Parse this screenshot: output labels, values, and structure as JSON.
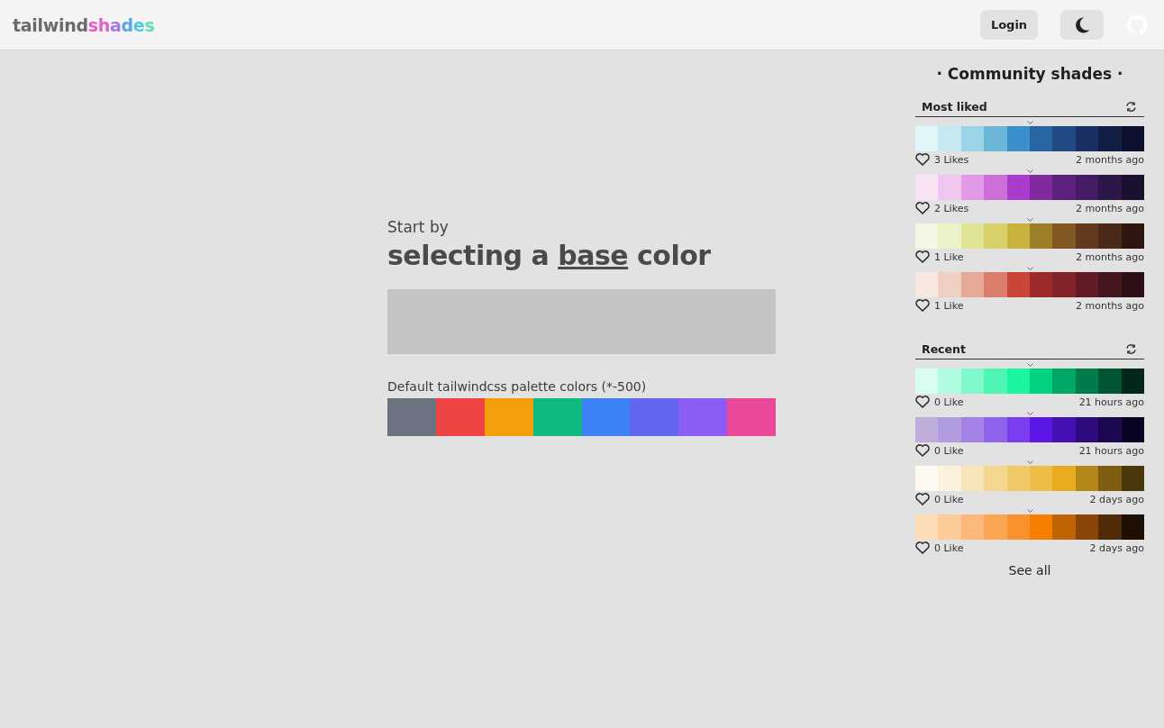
{
  "header": {
    "logo": [
      {
        "text": "tailwind",
        "color": "#6b6b6b"
      },
      {
        "text": "s",
        "color": "#e85bc6"
      },
      {
        "text": "h",
        "color": "#e15fd0"
      },
      {
        "text": "a",
        "color": "#a57ae0"
      },
      {
        "text": "d",
        "color": "#5aa6e6"
      },
      {
        "text": "e",
        "color": "#52c9dd"
      },
      {
        "text": "s",
        "color": "#5fe0b0"
      }
    ],
    "login": "Login"
  },
  "main": {
    "intro": "Start by",
    "heading_before": "selecting a ",
    "heading_link": "base",
    "heading_after": " color",
    "palette_label": "Default tailwindcss palette colors (*-500)",
    "defaults": [
      {
        "color": "#6b7280"
      },
      {
        "color": "#ef4444"
      },
      {
        "color": "#f59e0b"
      },
      {
        "color": "#10b981"
      },
      {
        "color": "#3b82f6"
      },
      {
        "color": "#6366f1"
      },
      {
        "color": "#8b5cf6"
      },
      {
        "color": "#ec4899"
      }
    ]
  },
  "sidebar": {
    "title": "· Community shades ·",
    "see_all": "See all",
    "sections": [
      {
        "title": "Most liked",
        "palettes": [
          {
            "likes": "3 Likes",
            "time": "2 months ago",
            "swatches": [
              {
                "color": "#e0f6f8"
              },
              {
                "color": "#c6e9f1"
              },
              {
                "color": "#9bd4e6"
              },
              {
                "color": "#6cb6d8"
              },
              {
                "color": "#3b90cc"
              },
              {
                "color": "#2766a3"
              },
              {
                "color": "#214a85"
              },
              {
                "color": "#1a2f63"
              },
              {
                "color": "#131e45"
              },
              {
                "color": "#0c102e"
              }
            ]
          },
          {
            "likes": "2 Likes",
            "time": "2 months ago",
            "swatches": [
              {
                "color": "#f8e3f7"
              },
              {
                "color": "#efc6ef"
              },
              {
                "color": "#e29ae6"
              },
              {
                "color": "#ce6ed8"
              },
              {
                "color": "#ab3bcc"
              },
              {
                "color": "#7f2a9e"
              },
              {
                "color": "#5f2180"
              },
              {
                "color": "#431c62"
              },
              {
                "color": "#2c1748"
              },
              {
                "color": "#1b1032"
              }
            ]
          },
          {
            "likes": "1 Like",
            "time": "2 months ago",
            "swatches": [
              {
                "color": "#f3f8e4"
              },
              {
                "color": "#ecf2c8"
              },
              {
                "color": "#e1e494"
              },
              {
                "color": "#d8d06a"
              },
              {
                "color": "#c9b23e"
              },
              {
                "color": "#a07f2a"
              },
              {
                "color": "#825824"
              },
              {
                "color": "#633a1e"
              },
              {
                "color": "#4a2918"
              },
              {
                "color": "#2e1510"
              }
            ]
          },
          {
            "likes": "1 Like",
            "time": "2 months ago",
            "swatches": [
              {
                "color": "#f8e8e2"
              },
              {
                "color": "#f1d0c4"
              },
              {
                "color": "#e6a897"
              },
              {
                "color": "#da7d6d"
              },
              {
                "color": "#c94538"
              },
              {
                "color": "#9f2a2a"
              },
              {
                "color": "#82222a"
              },
              {
                "color": "#621b26"
              },
              {
                "color": "#46161f"
              },
              {
                "color": "#2c0f14"
              }
            ]
          }
        ]
      },
      {
        "title": "Recent",
        "palettes": [
          {
            "likes": "0 Like",
            "time": "21 hours ago",
            "swatches": [
              {
                "color": "#d9fff0"
              },
              {
                "color": "#b0fce0"
              },
              {
                "color": "#7ff9cb"
              },
              {
                "color": "#4ff5b5"
              },
              {
                "color": "#1cf59f"
              },
              {
                "color": "#00d27e"
              },
              {
                "color": "#00a866"
              },
              {
                "color": "#007b4b"
              },
              {
                "color": "#015532"
              },
              {
                "color": "#01281a"
              }
            ]
          },
          {
            "likes": "0 Like",
            "time": "21 hours ago",
            "swatches": [
              {
                "color": "#bfaedc"
              },
              {
                "color": "#b29ce0"
              },
              {
                "color": "#a382e6"
              },
              {
                "color": "#9063ec"
              },
              {
                "color": "#7a3ef0"
              },
              {
                "color": "#5c17e6"
              },
              {
                "color": "#4510b4"
              },
              {
                "color": "#300b80"
              },
              {
                "color": "#1c0850"
              },
              {
                "color": "#0b0322"
              }
            ]
          },
          {
            "likes": "0 Like",
            "time": "2 days ago",
            "swatches": [
              {
                "color": "#fef9f2"
              },
              {
                "color": "#fbf1dc"
              },
              {
                "color": "#f7e4b8"
              },
              {
                "color": "#f3d68f"
              },
              {
                "color": "#efc868"
              },
              {
                "color": "#edbd48"
              },
              {
                "color": "#e8ab1e"
              },
              {
                "color": "#b58618"
              },
              {
                "color": "#7f5e12"
              },
              {
                "color": "#4b380a"
              }
            ]
          },
          {
            "likes": "0 Like",
            "time": "2 days ago",
            "swatches": [
              {
                "color": "#fddcb8"
              },
              {
                "color": "#fdcb98"
              },
              {
                "color": "#fcb878"
              },
              {
                "color": "#fba654"
              },
              {
                "color": "#f9922c"
              },
              {
                "color": "#f77f00"
              },
              {
                "color": "#c06305"
              },
              {
                "color": "#8a4506"
              },
              {
                "color": "#512a08"
              },
              {
                "color": "#1e0f04"
              }
            ]
          }
        ]
      }
    ]
  }
}
